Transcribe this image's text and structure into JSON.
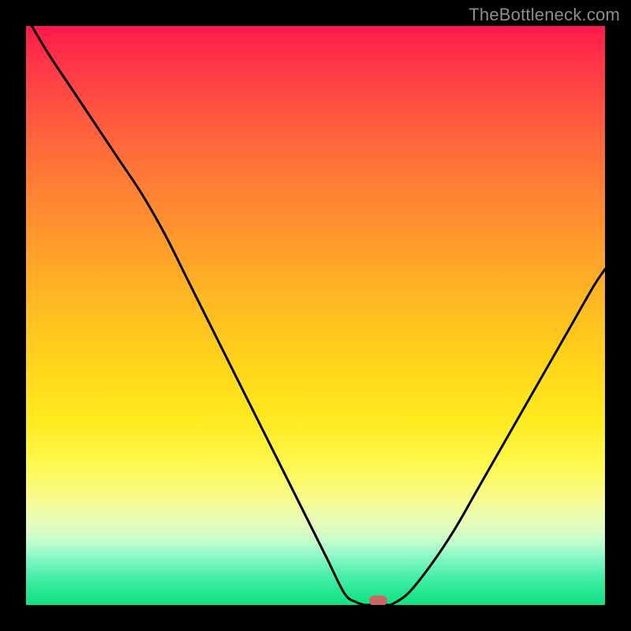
{
  "watermark": "TheBottleneck.com",
  "colors": {
    "frame": "#000000",
    "curve": "#000000",
    "marker": "#cc6666",
    "gradient_top": "#ff1a4a",
    "gradient_bottom": "#10e281"
  },
  "chart_data": {
    "type": "line",
    "title": "",
    "xlabel": "",
    "ylabel": "",
    "xlim": [
      0,
      100
    ],
    "ylim": [
      0,
      100
    ],
    "note": "Axes are percentage-normalized to plot area; y=0 is bottom (green), y=100 is top (red). The curve depicts a bottleneck V-shape reaching ~0 near x≈60.",
    "series": [
      {
        "name": "left-branch",
        "x": [
          1,
          4,
          8,
          12,
          16,
          20,
          24,
          28,
          32,
          36,
          40,
          44,
          48,
          52,
          55,
          57,
          58.5
        ],
        "values": [
          100,
          95,
          89,
          83,
          77,
          71,
          64,
          56,
          48,
          40,
          32,
          24,
          16,
          8,
          2,
          0.5,
          0
        ]
      },
      {
        "name": "flat-bottom",
        "x": [
          58.5,
          63
        ],
        "values": [
          0,
          0
        ]
      },
      {
        "name": "right-branch",
        "x": [
          63,
          66,
          70,
          74,
          78,
          82,
          86,
          90,
          94,
          98,
          100
        ],
        "values": [
          0,
          2,
          7,
          13,
          20,
          27,
          34,
          41,
          48,
          55,
          58
        ]
      }
    ],
    "marker": {
      "x": 60.8,
      "y": 0.8,
      "width_pct": 3.2,
      "height_pct": 1.8
    }
  }
}
